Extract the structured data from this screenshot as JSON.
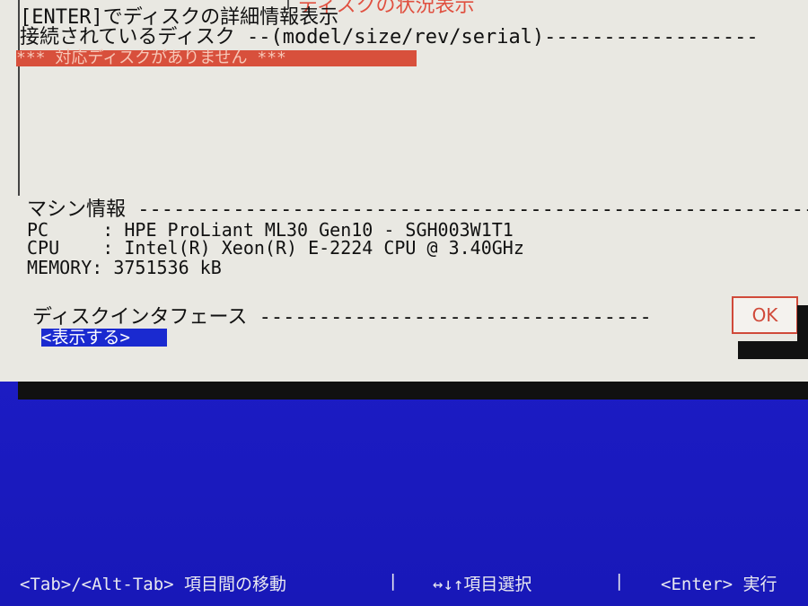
{
  "dialog": {
    "title_fragment": "ディスクの状況表示",
    "enter_hint": "[ENTER]でディスクの詳細情報表示",
    "connected_disks_header": "接続されているディスク --(model/size/rev/serial)------------------",
    "no_disk_error": "*** 対応ディスクがありません ***",
    "machine_info_header": "マシン情報 ---------------------------------------------------------",
    "machine_info": {
      "pc_line": "PC     : HPE ProLiant ML30 Gen10 - SGH003W1T1",
      "cpu_line": "CPU    : Intel(R) Xeon(R) E-2224 CPU @ 3.40GHz",
      "memory_line": "MEMORY: 3751536 kB"
    },
    "disk_interface_header": "ディスクインタフェース ---------------------------------",
    "show_link_label": "<表示する>",
    "ok_label": "OK"
  },
  "status_bar": {
    "tab_hint": "<Tab>/<Alt-Tab> 項目間の移動",
    "sep1": "|",
    "arrow_hint": "↔↓↑項目選択",
    "sep2": "|",
    "enter_hint": "<Enter> 実行"
  }
}
